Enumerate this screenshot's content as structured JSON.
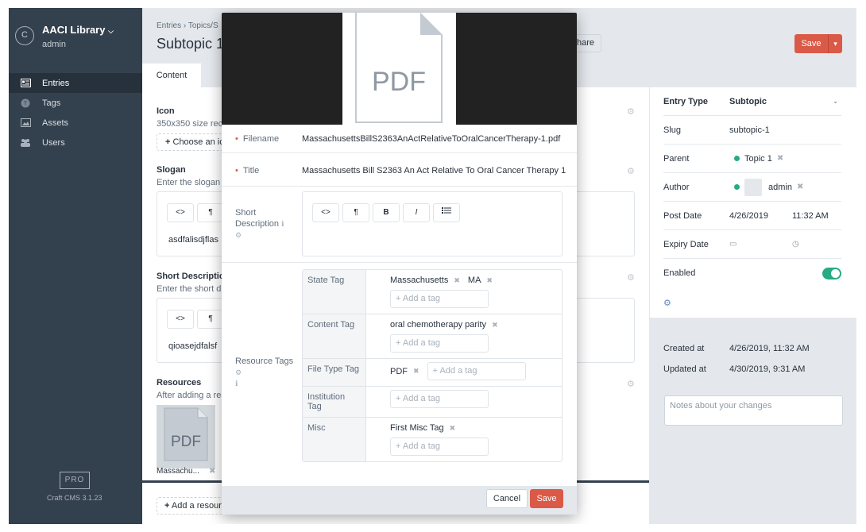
{
  "site": {
    "logo_letter": "C",
    "name": "AACI Library",
    "user": "admin"
  },
  "nav": [
    {
      "label": "Entries",
      "icon": "entries-icon",
      "active": true
    },
    {
      "label": "Tags",
      "icon": "tags-icon"
    },
    {
      "label": "Assets",
      "icon": "assets-icon"
    },
    {
      "label": "Users",
      "icon": "users-icon"
    }
  ],
  "footer": {
    "pro": "PRO",
    "version": "Craft CMS 3.1.23"
  },
  "header": {
    "breadcrumb": "Entries › Topics/S",
    "title": "Subtopic 1",
    "share_label": "Share",
    "save_label": "Save"
  },
  "tabs": {
    "content": "Content"
  },
  "form": {
    "icon_label": "Icon",
    "icon_help": "350x350 size rec",
    "choose_label": "Choose an ic",
    "slogan_label": "Slogan",
    "slogan_help": "Enter the slogan",
    "slogan_text": "asdfalisdjflas",
    "shortdesc_label": "Short Descriptio",
    "shortdesc_help": "Enter the short d",
    "shortdesc_text": "qioasejdfalsf",
    "resources_label": "Resources",
    "resources_help": "After adding a res",
    "resource_thumb_text": "PDF",
    "resource_name": "Massachu...",
    "add_resource": "Add a resour"
  },
  "rte_tools": [
    "<>",
    "¶",
    "B",
    "I",
    "list"
  ],
  "meta": {
    "entry_type_label": "Entry Type",
    "entry_type": "Subtopic",
    "slug_label": "Slug",
    "slug": "subtopic-1",
    "parent_label": "Parent",
    "parent": "Topic 1",
    "author_label": "Author",
    "author": "admin",
    "post_date_label": "Post Date",
    "post_date": "4/26/2019",
    "post_time": "11:32 AM",
    "expiry_label": "Expiry Date",
    "enabled_label": "Enabled",
    "created_label": "Created at",
    "created": "4/26/2019, 11:32 AM",
    "updated_label": "Updated at",
    "updated": "4/30/2019, 9:31 AM",
    "notes_placeholder": "Notes about your changes"
  },
  "modal": {
    "preview_text": "PDF",
    "filename_label": "Filename",
    "filename": "MassachusettsBillS2363AnActRelativeToOralCancerTherapy-1.pdf",
    "title_label": "Title",
    "title": "Massachusetts Bill S2363 An Act Relative To Oral Cancer Therapy 1",
    "short_desc_label": "Short Description",
    "resource_tags_label": "Resource Tags",
    "add_tag_placeholder": "Add a tag",
    "tag_groups": [
      {
        "name": "State Tag",
        "tags": [
          "Massachusetts",
          "MA"
        ]
      },
      {
        "name": "Content Tag",
        "tags": [
          "oral chemotherapy parity"
        ]
      },
      {
        "name": "File Type Tag",
        "tags": [
          "PDF"
        ]
      },
      {
        "name": "Institution Tag",
        "tags": []
      },
      {
        "name": "Misc",
        "tags": [
          "First Misc Tag"
        ]
      }
    ],
    "cancel_label": "Cancel",
    "save_label": "Save"
  },
  "colors": {
    "sidebar": "#33404d",
    "accent": "#da5a47",
    "enabled": "#27ab83"
  }
}
